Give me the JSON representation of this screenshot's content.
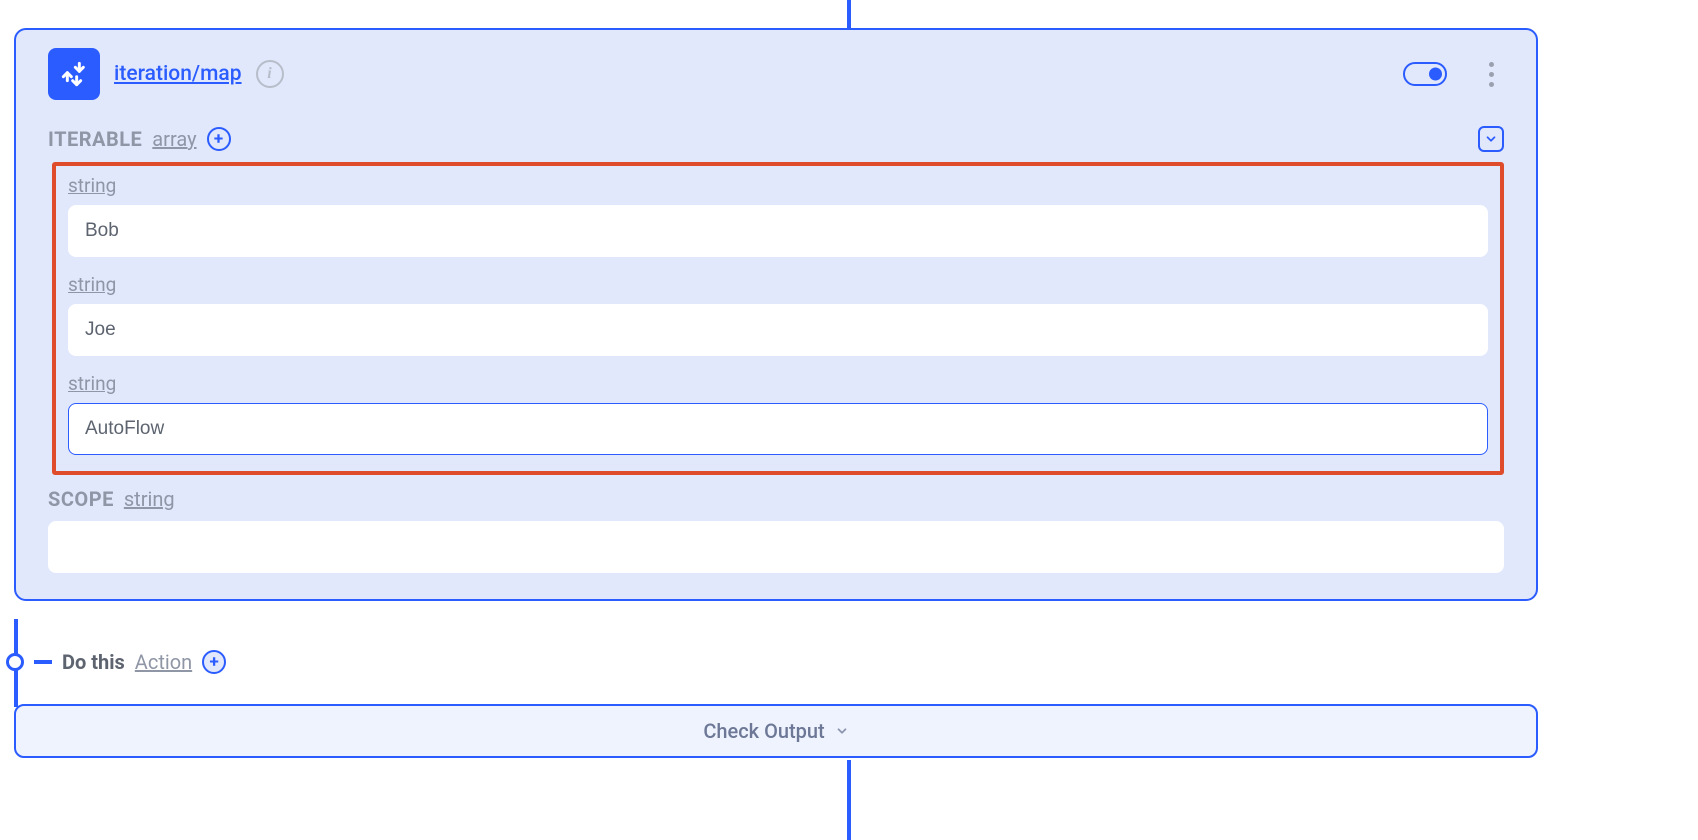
{
  "node": {
    "title": "iteration/map",
    "iterable": {
      "label": "ITERABLE",
      "type": "array",
      "items": [
        {
          "type": "string",
          "value": "Bob"
        },
        {
          "type": "string",
          "value": "Joe"
        },
        {
          "type": "string",
          "value": "AutoFlow"
        }
      ]
    },
    "scope": {
      "label": "SCOPE",
      "type": "string",
      "value": ""
    }
  },
  "doThis": {
    "label": "Do this",
    "actionLabel": "Action"
  },
  "checkOutput": {
    "label": "Check Output"
  }
}
